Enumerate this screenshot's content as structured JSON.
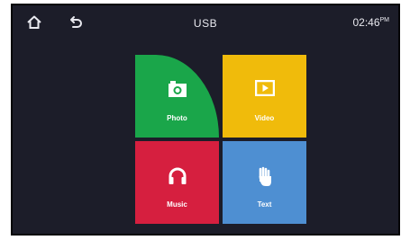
{
  "header": {
    "title": "USB",
    "time": "02:46",
    "time_suffix": "PM"
  },
  "icons": {
    "home": "home-icon",
    "back": "back-icon",
    "photo": "camera-icon",
    "video": "play-icon",
    "music": "headphones-icon",
    "text": "hand-icon"
  },
  "tiles": [
    {
      "label": "Photo",
      "color": "#1aa64a"
    },
    {
      "label": "Video",
      "color": "#f0bb0b"
    },
    {
      "label": "Music",
      "color": "#d61f3f"
    },
    {
      "label": "Text",
      "color": "#4e8fd2"
    }
  ]
}
